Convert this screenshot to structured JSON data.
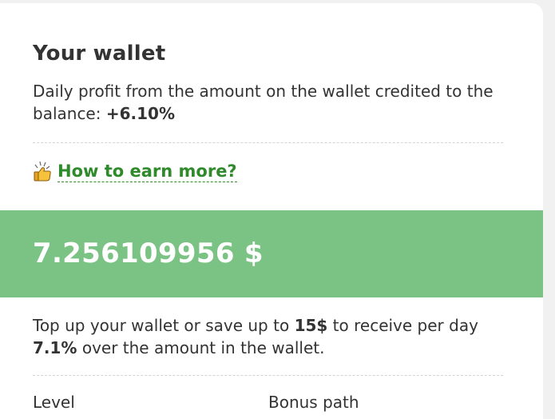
{
  "wallet": {
    "title": "Your wallet",
    "profit_text": "Daily profit from the amount on the wallet credited to the balance: ",
    "profit_value": "+6.10%",
    "earn_icon": "thumbs-up-icon",
    "earn_link": "How to earn more?",
    "balance": "7.256109956 $",
    "topup_text_1": "Top up your wallet or save up to ",
    "topup_amount": "15$",
    "topup_text_2": " to receive per day ",
    "topup_percent": "7.1%",
    "topup_text_3": " over the amount in the wallet.",
    "footer_left": "Level",
    "footer_right": "Bonus path"
  },
  "colors": {
    "accent_green": "#7bc384",
    "link_green": "#2f8a2b",
    "text": "#333333",
    "card": "#ffffff"
  }
}
